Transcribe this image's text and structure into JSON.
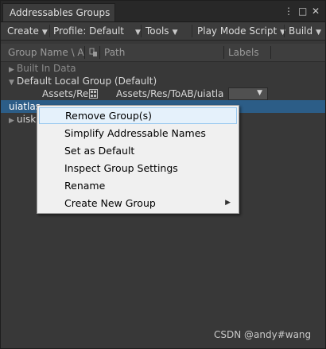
{
  "window": {
    "tab_title": "Addressables Groups",
    "controls": {
      "menu": "⋮",
      "maximize": "□",
      "close": "✕"
    }
  },
  "toolbar": {
    "create": "Create",
    "profile": "Profile: Default",
    "tools": "Tools",
    "play_mode_script": "Play Mode Script",
    "build": "Build",
    "dropdown_arrow": "▼"
  },
  "header": {
    "group_name": "Group Name \\ Ad",
    "path": "Path",
    "labels": "Labels"
  },
  "rows": {
    "built_in_data": "Built In Data",
    "default_group": "Default Local Group (Default)",
    "entry_address": "Assets/Re",
    "entry_path": "Assets/Res/ToAB/uiatlas",
    "uiatlas": "uiatlas",
    "uisk": "uisk",
    "fold_collapsed": "▶",
    "fold_expanded": "▼"
  },
  "context_menu": {
    "items": [
      "Remove Group(s)",
      "Simplify Addressable Names",
      "Set as Default",
      "Inspect Group Settings",
      "Rename",
      "Create New Group"
    ],
    "submenu_arrow": "▶"
  },
  "watermark": "CSDN @andy#wang",
  "colors": {
    "background": "#383838",
    "selection": "#2c5d87",
    "menu_background": "#f0f0f0",
    "menu_highlight": "#e5f1fb"
  }
}
